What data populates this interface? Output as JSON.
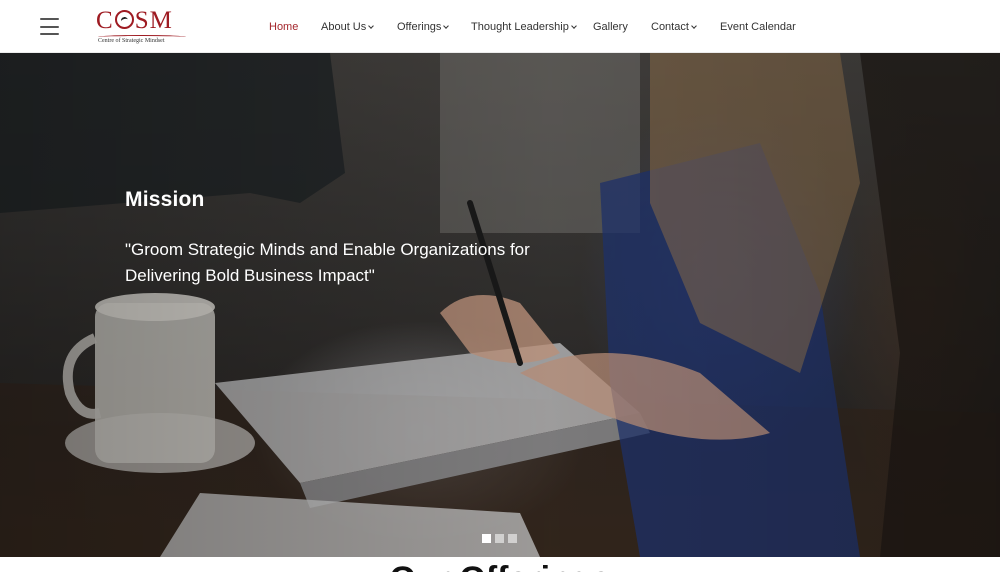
{
  "header": {
    "logo": {
      "mark": "COSM",
      "subtitle": "Centre of Strategic Mindset"
    },
    "nav": [
      {
        "label": "Home",
        "active": true,
        "has_dropdown": false
      },
      {
        "label": "About Us",
        "active": false,
        "has_dropdown": true
      },
      {
        "label": "Offerings",
        "active": false,
        "has_dropdown": true
      },
      {
        "label": "Thought Leadership",
        "active": false,
        "has_dropdown": true
      },
      {
        "label": "Gallery",
        "active": false,
        "has_dropdown": false
      },
      {
        "label": "Contact",
        "active": false,
        "has_dropdown": true
      },
      {
        "label": "Event Calendar",
        "active": false,
        "has_dropdown": false
      }
    ]
  },
  "hero": {
    "title": "Mission",
    "quote": "\"Groom Strategic Minds and Enable Organizations for Delivering Bold Business Impact\"",
    "slides": 3,
    "active_slide": 1
  },
  "section": {
    "heading": "Our Offerings"
  },
  "colors": {
    "brand": "#9e1b22",
    "active_nav": "#a4262c",
    "text": "#333333"
  },
  "icons": {
    "menu": "hamburger-menu-icon",
    "dropdown": "chevron-down-icon"
  }
}
